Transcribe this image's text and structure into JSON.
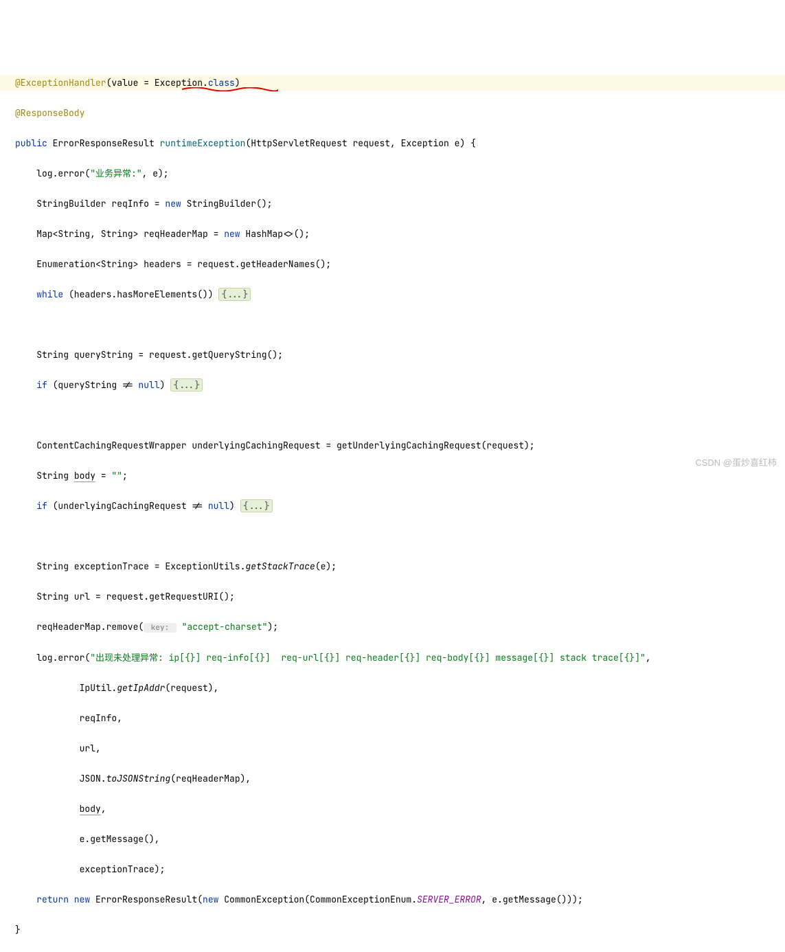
{
  "code": {
    "l1_annotation": "@ExceptionHandler",
    "l1_paren_open": "(value = ",
    "l1_exception": "Exception",
    "l1_dot": ".",
    "l1_class": "class",
    "l1_paren_close": ")",
    "l2_annotation": "@ResponseBody",
    "l3_public": "public",
    "l3_return_type": " ErrorResponseResult ",
    "l3_method_name": "runtimeException",
    "l3_params": "(HttpServletRequest request, Exception e) {",
    "l4_a": "    log.error(",
    "l4_str": "\"业务异常:\"",
    "l4_b": ", e);",
    "l5_a": "    StringBuilder reqInfo = ",
    "l5_new": "new",
    "l5_b": " StringBuilder();",
    "l6_a": "    Map<String, String> reqHeaderMap = ",
    "l6_new": "new",
    "l6_b": " HashMap<>();",
    "l7_a": "    Enumeration<String> headers = request.getHeaderNames();",
    "l8_while": "    while",
    "l8_a": " (headers.hasMoreElements()) ",
    "l8_fold": "{...}",
    "l10_a": "    String queryString = request.getQueryString();",
    "l11_if": "    if",
    "l11_a": " (queryString != ",
    "l11_null": "null",
    "l11_b": ") ",
    "l11_fold": "{...}",
    "l13_a": "    ContentCachingRequestWrapper underlyingCachingRequest = getUnderlyingCachingRequest(request);",
    "l14_a": "    String ",
    "l14_body": "body",
    "l14_b": " = ",
    "l14_str": "\"\"",
    "l14_c": ";",
    "l15_if": "    if",
    "l15_a": " (underlyingCachingRequest != ",
    "l15_null": "null",
    "l15_b": ") ",
    "l15_fold": "{...}",
    "l17_a": "    String exceptionTrace = ExceptionUtils.",
    "l17_m": "getStackTrace",
    "l17_b": "(e);",
    "l18_a": "    String url = request.getRequestURI();",
    "l19_a": "    reqHeaderMap.remove(",
    "l19_hint": " key: ",
    "l19_str": "\"accept-charset\"",
    "l19_b": ");",
    "l20_a": "    log.error(",
    "l20_str": "\"出现未处理异常: ip[{}] req-info[{}]  req-url[{}] req-header[{}] req-body[{}] message[{}] stack trace[{}]\"",
    "l20_b": ",",
    "l21_a": "            IpUtil.",
    "l21_m": "getIpAddr",
    "l21_b": "(request),",
    "l22_a": "            reqInfo,",
    "l23_a": "            url,",
    "l24_a": "            JSON.",
    "l24_m": "toJSONString",
    "l24_b": "(reqHeaderMap),",
    "l25_a": "            ",
    "l25_body": "body",
    "l25_b": ",",
    "l26_a": "            e.getMessage(),",
    "l27_a": "            exceptionTrace);",
    "l28_return": "    return new",
    "l28_a": " ErrorResponseResult(",
    "l28_new": "new",
    "l28_b": " CommonException(CommonExceptionEnum.",
    "l28_enum": "SERVER_ERROR",
    "l28_c": ", e.getMessage()));",
    "l29_a": "}"
  },
  "watermark": "CSDN @蛋炒喜红柿"
}
